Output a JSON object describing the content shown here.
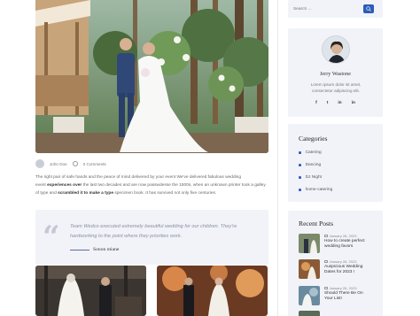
{
  "post": {
    "author": "John Doe",
    "comments": "0 Comments",
    "text_1": "The right pair of safe hands and the peace of mind delivered by your event We've delivered fabulous wedding",
    "text_2_prefix": "event ",
    "text_2_bold": "experiences over",
    "text_2_suffix": " the last two decades and are now passwdesse the 1500s, when an unknown printer took a galley",
    "text_3_prefix": "of type and ",
    "text_3_bold": "scrambled it to make a type",
    "text_3_suffix": " specimen book. It has survived not only five centuries."
  },
  "quote": {
    "mark": "“",
    "text": "Team Wedco executed extremely beautiful wedding for our children. They're hardworking to the point where they priorities work.",
    "author": "Sonon miane"
  },
  "sidebar": {
    "search_placeholder": "Search ...",
    "author": {
      "name": "Jerry Wastone",
      "bio": "Lorem ipsum dolor sit amet, consectetur adipiscing elit.",
      "social": [
        "f",
        "t",
        "in",
        "in"
      ]
    },
    "categories": {
      "title": "Categories",
      "items": [
        "Catering",
        "Dancing",
        "DJ Night",
        "home-catering"
      ]
    },
    "recent": {
      "title": "Recent Posts",
      "items": [
        {
          "date": "January 26, 2023",
          "title": "How to create perfect wedding favors"
        },
        {
          "date": "January 26, 2023",
          "title": "Auspicious Wedding Dates for 2023 !"
        },
        {
          "date": "January 26, 2023",
          "title": "Should There Be On Your List!"
        }
      ]
    }
  },
  "colors": {
    "accent": "#2d5cb8",
    "panel": "#f1f3f8"
  }
}
